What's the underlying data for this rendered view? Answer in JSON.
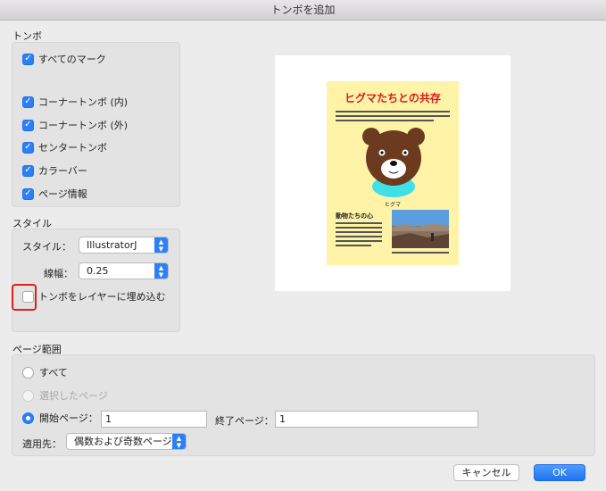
{
  "window": {
    "title": "トンボを追加"
  },
  "trim_marks": {
    "label": "トンボ",
    "items": [
      {
        "label": "すべてのマーク",
        "checked": true
      },
      {
        "label": "コーナートンボ (内)",
        "checked": true
      },
      {
        "label": "コーナートンボ (外)",
        "checked": true
      },
      {
        "label": "センタートンボ",
        "checked": true
      },
      {
        "label": "カラーバー",
        "checked": true
      },
      {
        "label": "ページ情報",
        "checked": true
      }
    ]
  },
  "style": {
    "label": "スタイル",
    "style_label": "スタイル：",
    "style_value": "IllustratorJ",
    "weight_label": "線幅：",
    "weight_value": "0.25",
    "embed_label": "トンボをレイヤーに埋め込む",
    "embed_checked": false
  },
  "preview": {
    "title": "ヒグマたちとの共存",
    "bear_caption": "ヒグマ",
    "subheading": "動物たちの心"
  },
  "page_range": {
    "label": "ページ範囲",
    "all_label": "すべて",
    "selected_label": "選択したページ",
    "start_label": "開始ページ：",
    "start_value": "1",
    "end_label": "終了ページ：",
    "end_value": "1",
    "apply_label": "適用先：",
    "apply_value": "偶数および奇数ページ",
    "selected_option": "start_page"
  },
  "buttons": {
    "cancel": "キャンセル",
    "ok": "OK"
  },
  "colors": {
    "accent": "#2d7ff9",
    "highlight": "#e01e1e",
    "page_bg": "#fff3a8",
    "title_red": "#d61b1b"
  }
}
